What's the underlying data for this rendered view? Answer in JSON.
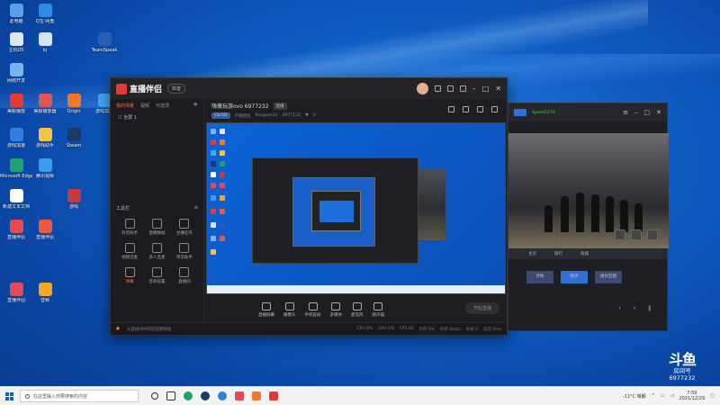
{
  "desktop": {
    "icons": [
      {
        "label": "此电脑",
        "color": "#5aa0e6"
      },
      {
        "label": "Q宝·网盘",
        "color": "#2e8ae6"
      },
      {
        "label": "主机OS",
        "color": "#e0e6ef"
      },
      {
        "label": "kj",
        "color": "#d7e3f5"
      },
      {
        "label": "TeamSpeak",
        "color": "#2a5db0"
      },
      {
        "label": "网络开发",
        "color": "#7ab4ef"
      },
      {
        "label": "美颜播放",
        "color": "#e53935"
      },
      {
        "label": "美颜播放器",
        "color": "#e05555"
      },
      {
        "label": "Origin",
        "color": "#f07a2a"
      },
      {
        "label": "游戏加速",
        "color": "#3ea7f0"
      },
      {
        "label": "游戏加速",
        "color": "#2d7ee0"
      },
      {
        "label": "游戏助手",
        "color": "#f6c343"
      },
      {
        "label": "Steam",
        "color": "#1b3a66"
      },
      {
        "label": "Microsoft Edge",
        "color": "#1fa36a"
      },
      {
        "label": "腾讯视频",
        "color": "#3a9bf0"
      },
      {
        "label": "新建文本文档",
        "color": "#ffffff"
      },
      {
        "label": "游戏",
        "color": "#c43b3b"
      },
      {
        "label": "直播伴侣",
        "color": "#e84b4b"
      },
      {
        "label": "直播伴侣",
        "color": "#ea5a3e"
      },
      {
        "label": "直播伴侣",
        "color": "#e24a5c"
      },
      {
        "label": "音频",
        "color": "#f5a623"
      }
    ]
  },
  "main_window": {
    "app_name": "直播伴侣",
    "badge": "抖音",
    "sidebar": {
      "tabs": [
        "我的场景",
        "视频",
        "可选项"
      ],
      "scene": "全屏 1",
      "tools_label": "工具栏",
      "tools": [
        {
          "name": "抖音助手",
          "icon": "chat-icon"
        },
        {
          "name": "直播数据",
          "icon": "people-icon"
        },
        {
          "name": "主播任务",
          "icon": "task-icon"
        },
        {
          "name": "视频连麦",
          "icon": "video-call-icon"
        },
        {
          "name": "多人连麦",
          "icon": "multi-call-icon"
        },
        {
          "name": "带货助手",
          "icon": "cart-icon"
        },
        {
          "name": "弹幕",
          "icon": "danmaku-icon",
          "active": true
        },
        {
          "name": "音效设置",
          "icon": "audio-icon"
        },
        {
          "name": "直播间",
          "icon": "room-icon"
        }
      ]
    },
    "room": {
      "title": "嗨傻玩游ovo 6977232",
      "tag": "直播",
      "game": "CS:GO",
      "sub1": "不限档位",
      "sub2": "Keegone11",
      "id": "6977232",
      "likes": "0"
    },
    "controls": [
      "直播屏幕",
      "摄像头",
      "手机投屏",
      "多媒体",
      "麦克风",
      "扬声器"
    ],
    "start_label": "开始直播",
    "status_warning": "从直播间中获得直播数据",
    "status_stats": [
      "CPU 0%",
      "GPU 0%",
      "FPS 60",
      "内存 0%",
      "码率 0kb/s",
      "丢帧 0",
      "延迟 0ms"
    ]
  },
  "second_window": {
    "account": "Speed1270",
    "tabs": [
      "主页",
      "排行",
      "商城"
    ],
    "buttons": [
      "开始",
      "购买",
      "组队匹配"
    ]
  },
  "watermark": {
    "text": "斗鱼",
    "sub": "房间号",
    "num": "6977232"
  },
  "taskbar": {
    "search_placeholder": "在这里输入你要搜索的内容",
    "weather": "-11°C 晴朗",
    "time": "7:59",
    "date": "2021/12/29"
  }
}
